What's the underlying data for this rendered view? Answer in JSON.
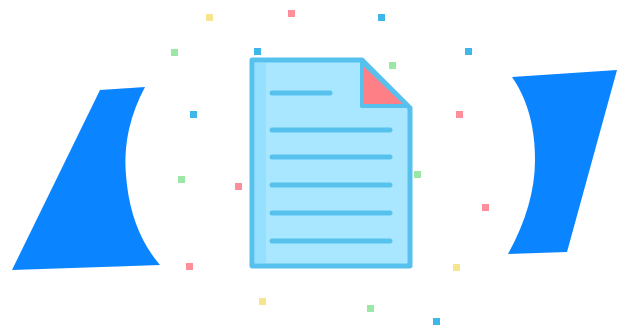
{
  "illustration": {
    "subject": "document-icon",
    "colors": {
      "background": "#ffffff",
      "bracket_blue": "#0a84ff",
      "doc_fill": "#a9e6ff",
      "doc_stroke": "#57c1ee",
      "doc_fold": "#ff7f86",
      "confetti_yellow": "#f6e58d",
      "confetti_pink": "#ff8e9b",
      "confetti_blue": "#3db8e8",
      "confetti_green": "#9be7a5"
    }
  }
}
